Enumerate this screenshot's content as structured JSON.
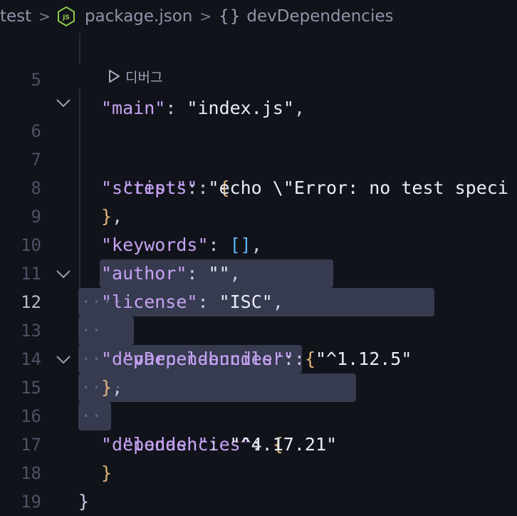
{
  "breadcrumb": {
    "folder": "test",
    "file": "package.json",
    "symbol": "devDependencies"
  },
  "codelens": {
    "label": "디버그"
  },
  "lines": [
    {
      "n": "5",
      "key": "\"main\"",
      "colon": ": ",
      "val": "\"index.js\"",
      "tail": ","
    },
    {
      "n": "6",
      "key": "\"scripts\"",
      "colon": ": ",
      "brace": "{"
    },
    {
      "n": "7",
      "key": "\"test\"",
      "colon": ": ",
      "val": "\"echo \\\"Error: no test speci"
    },
    {
      "n": "8",
      "brace": "}",
      "tail": ","
    },
    {
      "n": "9",
      "key": "\"keywords\"",
      "colon": ": ",
      "arr": "[]",
      "tail": ","
    },
    {
      "n": "10",
      "key": "\"author\"",
      "colon": ": ",
      "val": "\"\"",
      "tail": ","
    },
    {
      "n": "11",
      "key": "\"license\"",
      "colon": ": ",
      "val": "\"ISC\"",
      "tail": ","
    },
    {
      "n": "12",
      "key": "\"devDependencies\"",
      "colon": ": ",
      "brace": "{"
    },
    {
      "n": "13",
      "key": "\"parcel-bundler\"",
      "colon": ": ",
      "val": "\"^1.12.5\""
    },
    {
      "n": "14",
      "brace": "}",
      "tail": ","
    },
    {
      "n": "15",
      "key": "\"dependencies\"",
      "colon": ": ",
      "brace": "{"
    },
    {
      "n": "16",
      "key": "\"lodash\"",
      "colon": ": ",
      "val": "\"^4.17.21\""
    },
    {
      "n": "17",
      "brace": "}"
    },
    {
      "n": "18",
      "brace": "}"
    },
    {
      "n": "19"
    }
  ],
  "colors": {
    "background": "#11131a",
    "selection": "#363b50",
    "key": "#c6a2f2",
    "brace": "#e2b57a",
    "array": "#5eb5f5"
  }
}
